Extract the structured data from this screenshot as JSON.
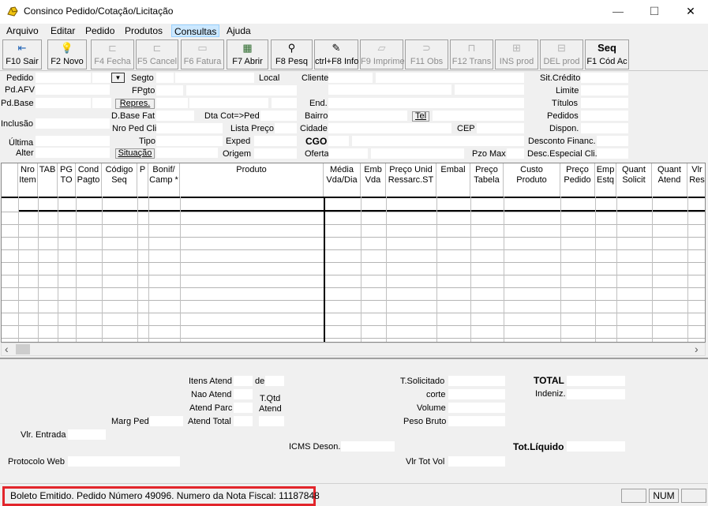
{
  "window": {
    "title": "Consinco Pedido/Cotação/Licitação",
    "minimize": "—",
    "maximize": "☐",
    "close": "✕"
  },
  "menu": [
    "Arquivo",
    "Editar",
    "Pedido",
    "Produtos",
    "Consultas",
    "Ajuda"
  ],
  "toolbar": [
    {
      "icon": "exit-icon",
      "glyph": "⇤",
      "label": "F10 Sair"
    },
    {
      "icon": "lightbulb-icon",
      "glyph": "💡",
      "label": "F2 Novo"
    },
    {
      "icon": "close-order-icon",
      "glyph": "⊏",
      "label": "F4 Fecha"
    },
    {
      "icon": "cancel-icon",
      "glyph": "⊏",
      "label": "F5 Cancel"
    },
    {
      "icon": "invoice-icon",
      "glyph": "▭",
      "label": "F6 Fatura"
    },
    {
      "icon": "open-icon",
      "glyph": "▦",
      "label": "F7 Abrir"
    },
    {
      "icon": "binoculars-icon",
      "glyph": "⚲",
      "label": "F8 Pesq"
    },
    {
      "icon": "info-icon",
      "glyph": "✎",
      "label": "ctrl+F8 Info"
    },
    {
      "icon": "print-icon",
      "glyph": "▱",
      "label": "F9 Imprime"
    },
    {
      "icon": "notes-icon",
      "glyph": "⊃",
      "label": "F11 Obs"
    },
    {
      "icon": "transfer-icon",
      "glyph": "⊓",
      "label": "F12 Trans"
    },
    {
      "icon": "insert-product-icon",
      "glyph": "⊞",
      "label": "INS prod"
    },
    {
      "icon": "delete-product-icon",
      "glyph": "⊟",
      "label": "DEL prod"
    },
    {
      "icon": "seq-icon",
      "glyph": "Seq",
      "label": "F1 Cód Ac"
    }
  ],
  "form": {
    "pedido": "Pedido",
    "segto": "Segto",
    "local": "Local",
    "cliente": "Cliente",
    "sit_credito": "Sit.Crédito",
    "pd_afv": "Pd.AFV",
    "fpgto": "FPgto",
    "limite": "Limite",
    "pd_base": "Pd.Base",
    "repres": "Repres.",
    "end": "End.",
    "titulos": "Títulos",
    "d_base_fat": "D.Base Fat",
    "dta_cot": "Dta Cot=>Ped",
    "bairro": "Bairro",
    "tel": "Tel",
    "pedidos": "Pedidos",
    "inclusao": "Inclusão",
    "nro_ped_cli": "Nro Ped Cli",
    "lista_preco": "Lista Preço",
    "cidade": "Cidade",
    "cep": "CEP",
    "dispon": "Dispon.",
    "ultima": "Última",
    "tipo": "Tipo",
    "exped": "Exped",
    "cgo": "CGO",
    "desconto_financ": "Desconto Financ.",
    "alter": "Alter",
    "situacao": "Situação",
    "origem": "Origem",
    "oferta": "Oferta",
    "pzo_max": "Pzo Max",
    "desc_especial": "Desc.Especial Cli."
  },
  "grid": {
    "columns": [
      {
        "l1": "Nro",
        "l2": "Item"
      },
      {
        "l1": "TAB",
        "l2": ""
      },
      {
        "l1": "PG",
        "l2": "TO"
      },
      {
        "l1": "Cond",
        "l2": "Pagto"
      },
      {
        "l1": "Código",
        "l2": "Seq"
      },
      {
        "l1": "P",
        "l2": ""
      },
      {
        "l1": "Bonif/",
        "l2": "Camp *"
      },
      {
        "l1": "Produto",
        "l2": ""
      },
      {
        "l1": "Média",
        "l2": "Vda/Dia"
      },
      {
        "l1": "Emb",
        "l2": "Vda"
      },
      {
        "l1": "Preço Unid",
        "l2": "Ressarc.ST"
      },
      {
        "l1": "Embal",
        "l2": ""
      },
      {
        "l1": "Preço",
        "l2": "Tabela"
      },
      {
        "l1": "Custo",
        "l2": "Produto"
      },
      {
        "l1": "Preço",
        "l2": "Pedido"
      },
      {
        "l1": "Emp",
        "l2": "Estq"
      },
      {
        "l1": "Quant",
        "l2": "Solicit"
      },
      {
        "l1": "Quant",
        "l2": "Atend"
      },
      {
        "l1": "Vlr",
        "l2": "Res"
      }
    ],
    "scroll_left": "‹",
    "scroll_right": "›"
  },
  "summary": {
    "itens_atend": "Itens Atend",
    "de": "de",
    "nao_atend": "Nao Atend",
    "t_qtd": "T.Qtd",
    "atend_parc": "Atend Parc",
    "atend": "Atend",
    "marg_ped": "Marg Ped",
    "atend_total": "Atend Total",
    "vlr_entrada": "Vlr. Entrada",
    "icms_deson": "ICMS Deson.",
    "protocolo_web": "Protocolo Web",
    "t_solicitado": "T.Solicitado",
    "corte": "corte",
    "volume": "Volume",
    "peso_bruto": "Peso Bruto",
    "vlr_tot_vol": "Vlr Tot Vol",
    "total": "TOTAL",
    "indeniz": "Indeniz.",
    "tot_liquido": "Tot.Líquido"
  },
  "status": {
    "message": "Boleto Emitido. Pedido Número 49096. Numero da Nota Fiscal: 11187848",
    "num": "NUM"
  }
}
